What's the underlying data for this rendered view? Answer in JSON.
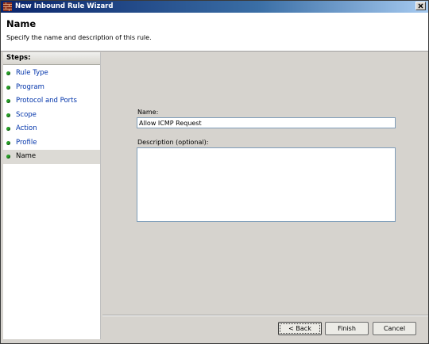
{
  "window": {
    "title": "New Inbound Rule Wizard",
    "close_glyph": "×"
  },
  "header": {
    "title": "Name",
    "description": "Specify the name and description of this rule."
  },
  "steps": {
    "heading": "Steps:",
    "items": [
      {
        "label": "Rule Type"
      },
      {
        "label": "Program"
      },
      {
        "label": "Protocol and Ports"
      },
      {
        "label": "Scope"
      },
      {
        "label": "Action"
      },
      {
        "label": "Profile"
      },
      {
        "label": "Name"
      }
    ],
    "current": "Name"
  },
  "form": {
    "name_label": "Name:",
    "name_value": "Allow ICMP Request",
    "description_label": "Description (optional):",
    "description_value": ""
  },
  "buttons": {
    "back": "< Back",
    "finish": "Finish",
    "cancel": "Cancel"
  },
  "colors": {
    "link": "#0033aa",
    "step_dot": "#2aa02a",
    "dialog_bg": "#d6d3ce"
  }
}
